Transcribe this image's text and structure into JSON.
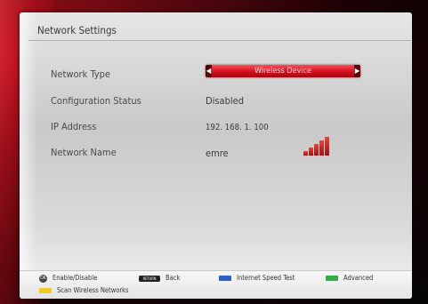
{
  "title": "Network Settings",
  "rows": [
    {
      "label": "Network Type",
      "value": "Wireless Device"
    },
    {
      "label": "Configuration Status",
      "value": "Disabled"
    },
    {
      "label": "IP Address",
      "value": "192. 168. 1. 100"
    },
    {
      "label": "Network Name",
      "value": "emre"
    }
  ],
  "signal_strength_bars": 5,
  "footer": {
    "enable": "Enable/Disable",
    "ok_key": "OK",
    "back": "Back",
    "return_key": "RETURN",
    "speed_test": "Internet Speed Test",
    "advanced": "Advanced",
    "scan": "Scan Wireless Networks"
  },
  "colors": {
    "accent_red": "#d0101e",
    "blue_key": "#2e5fc8",
    "green_key": "#2fae4a",
    "yellow_key": "#f2cc1e"
  }
}
